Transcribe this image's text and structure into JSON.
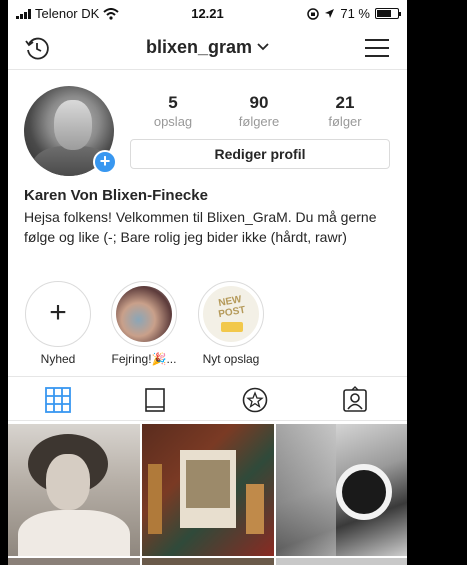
{
  "status_bar": {
    "carrier": "Telenor DK",
    "time": "12.21",
    "battery": "71 %"
  },
  "nav": {
    "username": "blixen_gram",
    "username_chevron": "⌄"
  },
  "stats": [
    {
      "num": "5",
      "label": "opslag"
    },
    {
      "num": "90",
      "label": "følgere"
    },
    {
      "num": "21",
      "label": "følger"
    }
  ],
  "edit_profile_label": "Rediger profil",
  "profile": {
    "name": "Karen Von Blixen-Finecke",
    "bio": "Hejsa folkens! Velkommen til Blixen_GraM. Du må gerne følge og like (-; Bare rolig jeg bider ikke (hårdt, rawr)"
  },
  "highlights": [
    {
      "label": "Nyhed",
      "icon": "plus-icon"
    },
    {
      "label": "Fejring!🎉..."
    },
    {
      "label": "Nyt opslag",
      "cover_text": "NEW POST"
    }
  ],
  "tabs": [
    {
      "icon": "grid-icon",
      "active": true
    },
    {
      "icon": "feed-list-icon",
      "active": false
    },
    {
      "icon": "saved-star-icon",
      "active": false
    },
    {
      "icon": "tagged-person-icon",
      "active": false
    }
  ],
  "colors": {
    "accent": "#3897f0",
    "text": "#262626",
    "muted": "#999999",
    "border": "#dbdbdb"
  }
}
